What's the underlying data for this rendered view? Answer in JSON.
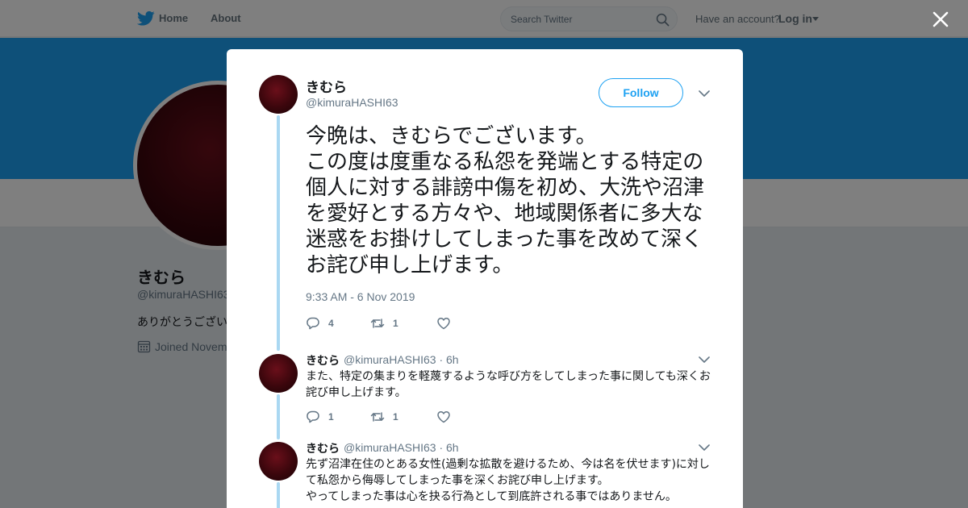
{
  "nav": {
    "home": "Home",
    "about": "About",
    "search_placeholder": "Search Twitter",
    "have_account": "Have an account?",
    "login": "Log in"
  },
  "profile": {
    "name": "きむら",
    "handle": "@kimuraHASHI63",
    "bio": "ありがとうござい",
    "joined": "Joined Novem"
  },
  "main_tweet": {
    "name": "きむら",
    "handle": "@kimuraHASHI63",
    "follow_label": "Follow",
    "text": "今晩は、きむらでございます。\nこの度は度重なる私怨を発端とする特定の個人に対する誹謗中傷を初め、大洗や沼津を愛好とする方々や、地域関係者に多大な迷惑をお掛けしてしまった事を改めて深くお詫び申し上げます。",
    "timestamp": "9:33 AM - 6 Nov 2019",
    "replies": "4",
    "retweets": "1"
  },
  "replies": [
    {
      "name": "きむら",
      "handle": "@kimuraHASHI63",
      "time": "· 6h",
      "text": "また、特定の集まりを軽蔑するような呼び方をしてしまった事に関しても深くお詫び申し上げます。",
      "replies": "1",
      "retweets": "1"
    },
    {
      "name": "きむら",
      "handle": "@kimuraHASHI63",
      "time": "· 6h",
      "text": "先ず沼津在住のとある女性(過剰な拡散を避けるため、今は名を伏せます)に対して私怨から侮辱してしまった事を深くお詫び申し上げます。\nやってしまった事は心を抉る行為として到底許される事ではありません。"
    }
  ],
  "colors": {
    "twitter_blue": "#1da1f2",
    "thread_line": "#aad8f2",
    "secondary_text": "#657786"
  },
  "icons": [
    "twitter-bird-icon",
    "search-icon",
    "caret-down-icon",
    "close-icon",
    "calendar-icon",
    "reply-icon",
    "retweet-icon",
    "like-icon",
    "chevron-down-icon"
  ]
}
